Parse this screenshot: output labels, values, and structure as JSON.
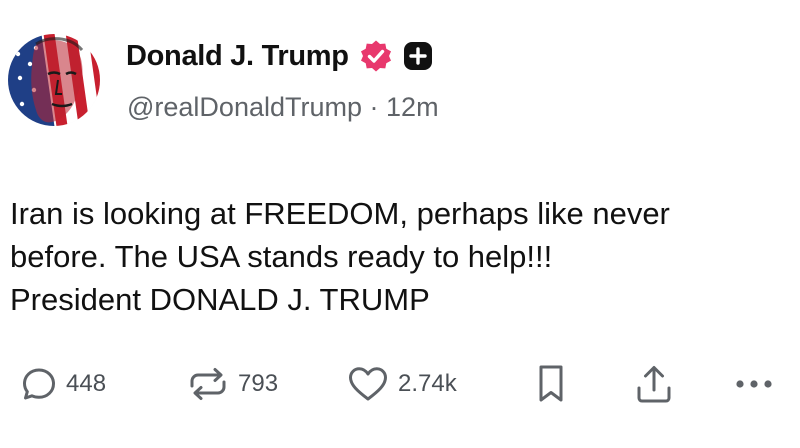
{
  "post": {
    "author": {
      "display_name": "Donald J. Trump",
      "handle": "@realDonaldTrump",
      "separator": "·",
      "time_ago": "12m",
      "verified_badge_icon": "verified-check-icon",
      "plus_badge_icon": "plus-square-icon"
    },
    "text_lines": [
      "Iran is looking at FREEDOM, perhaps like never",
      "before. The USA stands ready to help!!!",
      "President DONALD J. TRUMP"
    ],
    "actions": {
      "replies": {
        "icon": "reply-bubble-icon",
        "count": "448"
      },
      "reposts": {
        "icon": "repost-arrows-icon",
        "count": "793"
      },
      "likes": {
        "icon": "heart-icon",
        "count": "2.74k"
      },
      "bookmark": {
        "icon": "bookmark-icon"
      },
      "share": {
        "icon": "share-upload-icon"
      },
      "more": {
        "icon": "more-dots-icon"
      }
    }
  },
  "colors": {
    "text": "#111111",
    "muted": "#5f6368",
    "verified_badge": "#e8386d",
    "plus_badge": "#111111"
  }
}
